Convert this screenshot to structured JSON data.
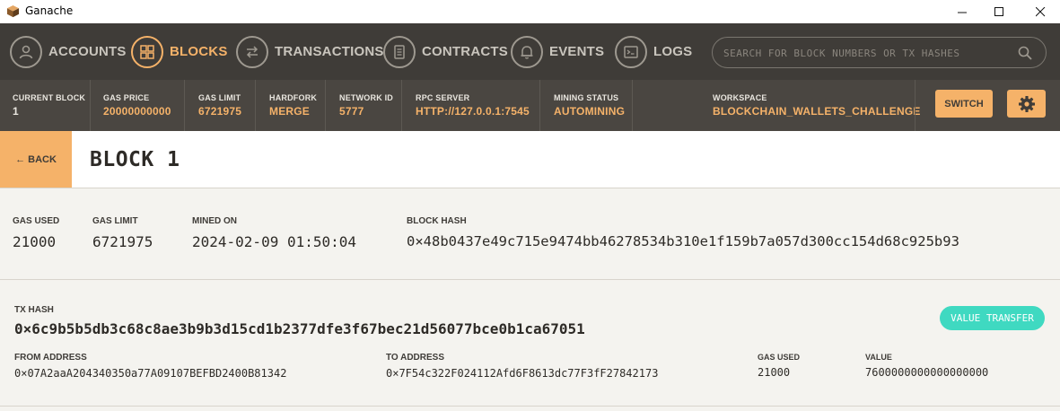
{
  "window": {
    "title": "Ganache",
    "minimize": "—",
    "maximize": "☐",
    "close": "✕"
  },
  "nav": {
    "items": [
      {
        "label": "ACCOUNTS",
        "icon": "user-icon",
        "active": false
      },
      {
        "label": "BLOCKS",
        "icon": "blocks-icon",
        "active": true
      },
      {
        "label": "TRANSACTIONS",
        "icon": "transactions-icon",
        "active": false
      },
      {
        "label": "CONTRACTS",
        "icon": "contracts-icon",
        "active": false
      },
      {
        "label": "EVENTS",
        "icon": "bell-icon",
        "active": false
      },
      {
        "label": "LOGS",
        "icon": "terminal-icon",
        "active": false
      }
    ],
    "search_placeholder": "SEARCH FOR BLOCK NUMBERS OR TX HASHES"
  },
  "stats": {
    "current_block": {
      "label": "CURRENT BLOCK",
      "value": "1"
    },
    "gas_price": {
      "label": "GAS PRICE",
      "value": "20000000000"
    },
    "gas_limit": {
      "label": "GAS LIMIT",
      "value": "6721975"
    },
    "hardfork": {
      "label": "HARDFORK",
      "value": "MERGE"
    },
    "network_id": {
      "label": "NETWORK ID",
      "value": "5777"
    },
    "rpc_server": {
      "label": "RPC SERVER",
      "value": "HTTP://127.0.0.1:7545"
    },
    "mining_status": {
      "label": "MINING STATUS",
      "value": "AUTOMINING"
    },
    "workspace": {
      "label": "WORKSPACE",
      "value": "BLOCKCHAIN_WALLETS_CHALLENGE"
    },
    "switch_label": "SWITCH"
  },
  "header": {
    "back_label": "← BACK",
    "title": "BLOCK 1"
  },
  "block": {
    "gas_used": {
      "label": "GAS USED",
      "value": "21000"
    },
    "gas_limit": {
      "label": "GAS LIMIT",
      "value": "6721975"
    },
    "mined_on": {
      "label": "MINED ON",
      "value": "2024-02-09 01:50:04"
    },
    "block_hash": {
      "label": "BLOCK HASH",
      "value": "0×48b0437e49c715e9474bb46278534b310e1f159b7a057d300cc154d68c925b93"
    }
  },
  "transaction": {
    "hash_label": "TX HASH",
    "hash": "0×6c9b5b5db3c68c8ae3b9b3d15cd1b2377dfe3f67bec21d56077bce0b1ca67051",
    "badge": "VALUE TRANSFER",
    "from": {
      "label": "FROM ADDRESS",
      "value": "0×07A2aaA204340350a77A09107BEFBD2400B81342"
    },
    "to": {
      "label": "TO ADDRESS",
      "value": "0×7F54c322F024112Afd6F8613dc77F3fF27842173"
    },
    "gas_used": {
      "label": "GAS USED",
      "value": "21000"
    },
    "value": {
      "label": "VALUE",
      "value": "7600000000000000000"
    }
  },
  "colors": {
    "accent": "#f5b269",
    "nav_bg": "#3f3c38",
    "stats_bg": "#4a4641",
    "badge": "#3fd9c1",
    "page_bg": "#f4f3ef"
  }
}
